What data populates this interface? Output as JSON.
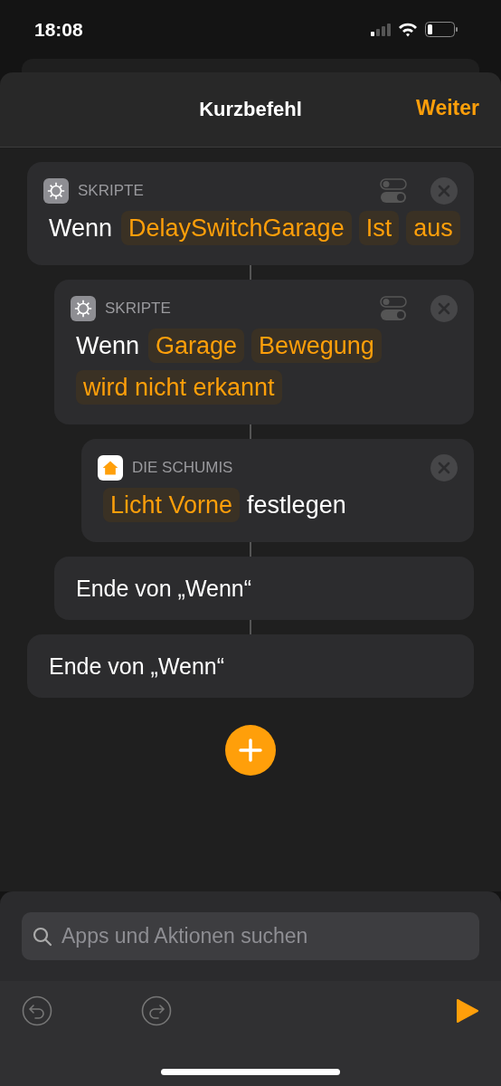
{
  "status_bar": {
    "time": "18:08"
  },
  "header": {
    "title": "Kurzbefehl",
    "next": "Weiter"
  },
  "blocks": [
    {
      "kind": "if",
      "app": "SKRIPTE",
      "tokens": [
        {
          "kind": "plain",
          "text": "Wenn"
        },
        {
          "kind": "variable",
          "text": "DelaySwitchGarage"
        },
        {
          "kind": "variable",
          "text": "Ist"
        },
        {
          "kind": "variable",
          "text": "aus"
        }
      ],
      "end": "Ende von „Wenn“",
      "children": [
        {
          "kind": "if",
          "app": "SKRIPTE",
          "tokens": [
            {
              "kind": "plain",
              "text": "Wenn"
            },
            {
              "kind": "variable",
              "text": "Garage"
            },
            {
              "kind": "variable",
              "text": "Bewegung"
            },
            {
              "kind": "variable",
              "text": "wird nicht erkannt"
            }
          ],
          "end": "Ende von „Wenn“",
          "children": [
            {
              "kind": "action",
              "app": "DIE SCHUMIS",
              "tokens": [
                {
                  "kind": "variable",
                  "text": "Licht Vorne"
                },
                {
                  "kind": "plain",
                  "text": "festlegen"
                }
              ]
            }
          ]
        }
      ]
    }
  ],
  "search": {
    "placeholder": "Apps und Aktionen suchen"
  }
}
